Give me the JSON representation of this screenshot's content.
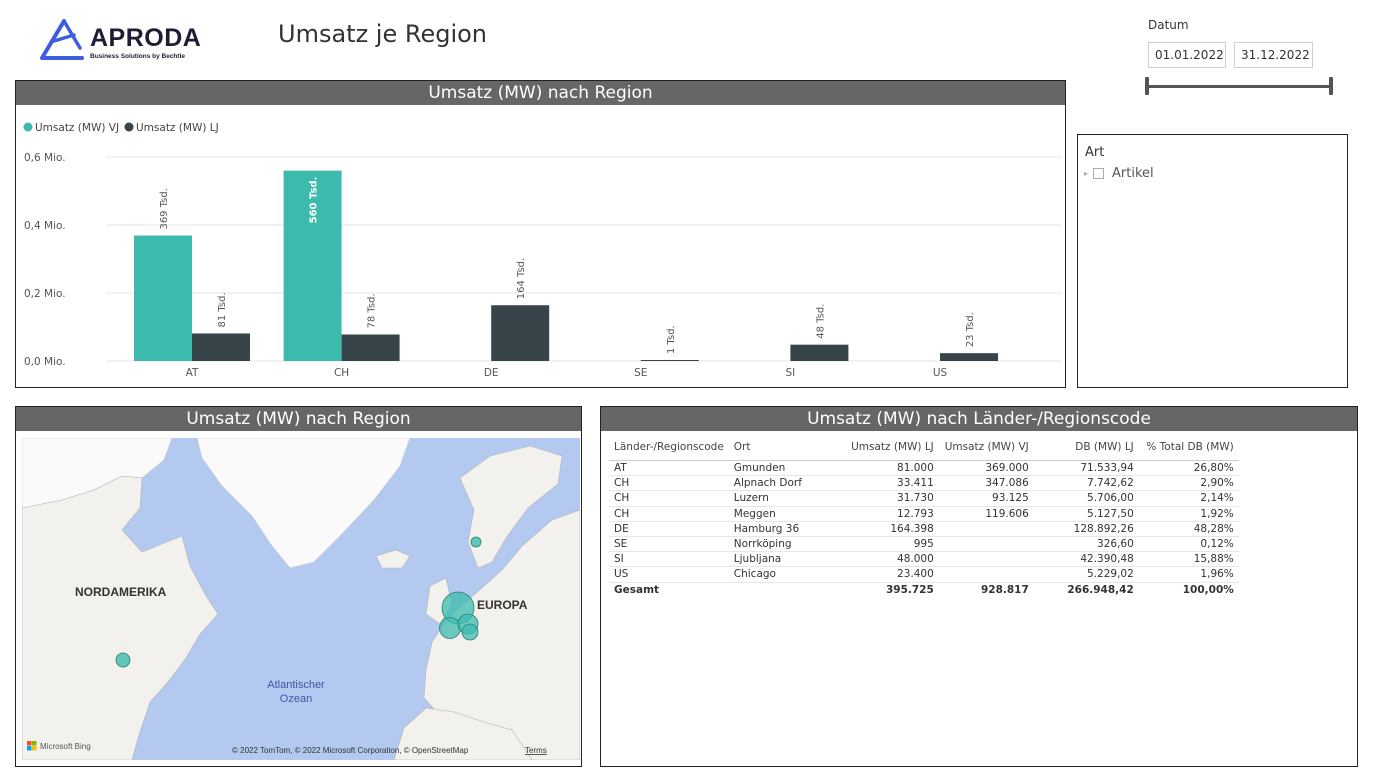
{
  "logo": {
    "name": "APRODA",
    "tagline": "Business Solutions by Bechtle"
  },
  "page_title": "Umsatz je Region",
  "date_filter": {
    "label": "Datum",
    "from": "01.01.2022",
    "to": "31.12.2022"
  },
  "bar_panel": {
    "title": "Umsatz (MW) nach Region"
  },
  "chart_data": {
    "type": "bar",
    "title": "Umsatz (MW) nach Region",
    "categories": [
      "AT",
      "CH",
      "DE",
      "SE",
      "SI",
      "US"
    ],
    "series": [
      {
        "name": "Umsatz (MW) VJ",
        "color": "#3cbbad",
        "values": [
          369000,
          560000,
          0,
          0,
          0,
          0
        ],
        "labels": [
          "369 Tsd.",
          "560 Tsd.",
          "",
          "",
          "",
          ""
        ]
      },
      {
        "name": "Umsatz (MW) LJ",
        "color": "#374449",
        "values": [
          81000,
          78000,
          164000,
          1000,
          48000,
          23000
        ],
        "labels": [
          "81 Tsd.",
          "78 Tsd.",
          "164 Tsd.",
          "1 Tsd.",
          "48 Tsd.",
          "23 Tsd."
        ]
      }
    ],
    "yticks": [
      0,
      200000,
      400000,
      600000
    ],
    "ytick_labels": [
      "0,0 Mio.",
      "0,2 Mio.",
      "0,4 Mio.",
      "0,6 Mio."
    ],
    "ylim": [
      0,
      600000
    ],
    "legend_position": "top-left",
    "grid": true
  },
  "slicer": {
    "title": "Art",
    "item": "Artikel"
  },
  "map_panel": {
    "title": "Umsatz (MW) nach Region",
    "labels": {
      "north_america": "NORDAMERIKA",
      "europe": "EUROPA",
      "ocean_line1": "Atlantischer",
      "ocean_line2": "Ozean"
    },
    "attribution": "© 2022 TomTom, © 2022 Microsoft Corporation, © OpenStreetMap",
    "terms": "Terms",
    "bing": "Microsoft Bing"
  },
  "table_panel": {
    "title": "Umsatz (MW) nach Länder-/Regionscode",
    "columns": [
      "Länder-/Regionscode",
      "Ort",
      "Umsatz (MW) LJ",
      "Umsatz (MW) VJ",
      "DB (MW) LJ",
      "% Total DB (MW)"
    ],
    "rows": [
      [
        "AT",
        "Gmunden",
        "81.000",
        "369.000",
        "71.533,94",
        "26,80%"
      ],
      [
        "CH",
        "Alpnach Dorf",
        "33.411",
        "347.086",
        "7.742,62",
        "2,90%"
      ],
      [
        "CH",
        "Luzern",
        "31.730",
        "93.125",
        "5.706,00",
        "2,14%"
      ],
      [
        "CH",
        "Meggen",
        "12.793",
        "119.606",
        "5.127,50",
        "1,92%"
      ],
      [
        "DE",
        "Hamburg 36",
        "164.398",
        "",
        "128.892,26",
        "48,28%"
      ],
      [
        "SE",
        "Norrköping",
        "995",
        "",
        "326,60",
        "0,12%"
      ],
      [
        "SI",
        "Ljubljana",
        "48.000",
        "",
        "42.390,48",
        "15,88%"
      ],
      [
        "US",
        "Chicago",
        "23.400",
        "",
        "5.229,02",
        "1,96%"
      ]
    ],
    "total": [
      "Gesamt",
      "",
      "395.725",
      "928.817",
      "266.948,42",
      "100,00%"
    ]
  },
  "colors": {
    "header": "#666666",
    "teal": "#3cbbad",
    "dark": "#374449",
    "ocean": "#b3c9f0",
    "land": "#f2f1ee",
    "ice": "#fafafa",
    "logo_blue": "#3d5ce0"
  }
}
